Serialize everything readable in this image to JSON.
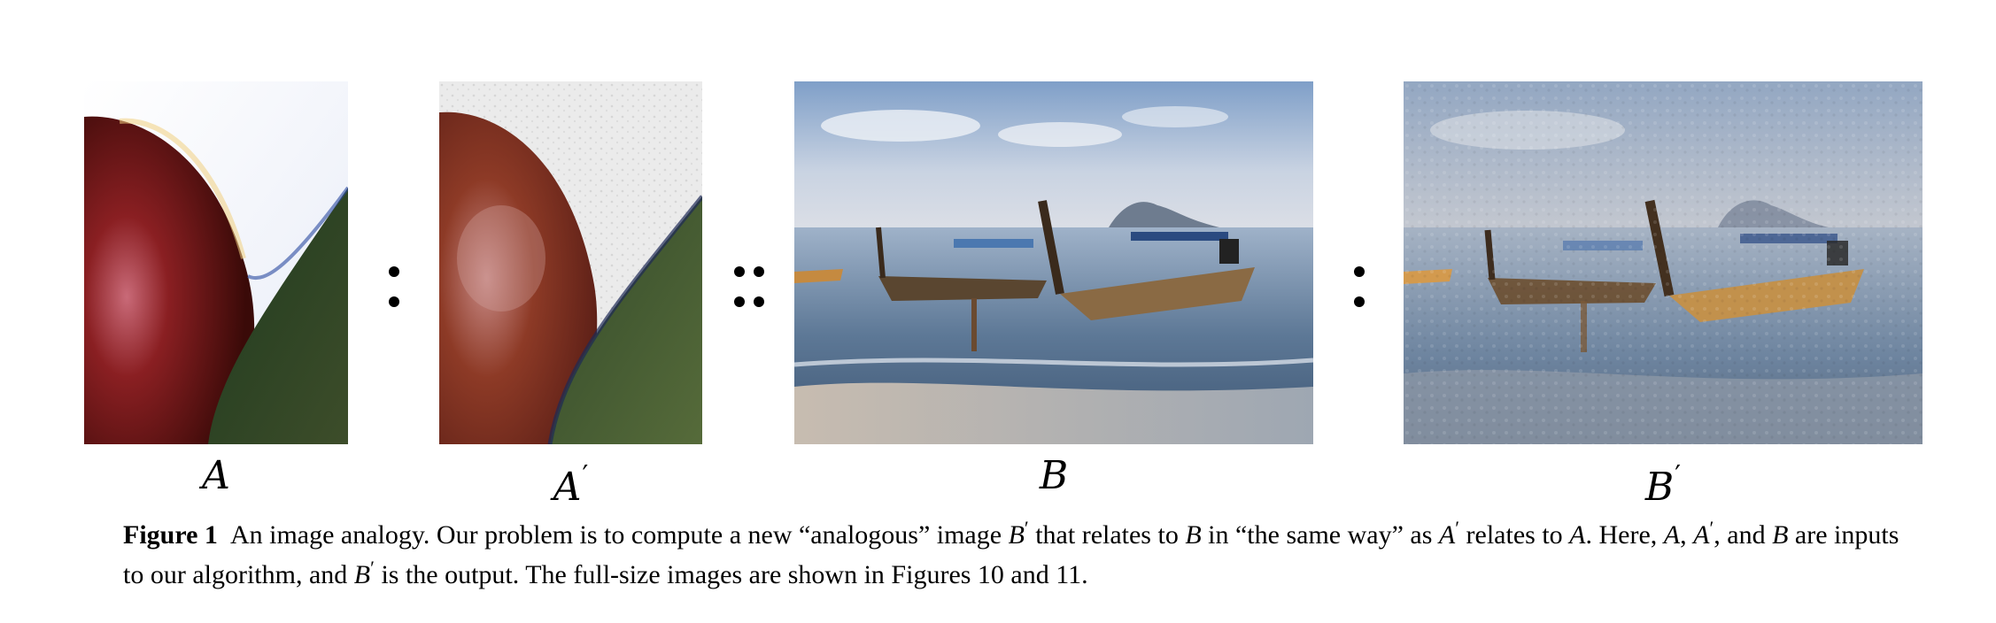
{
  "labels": {
    "a": "A",
    "a_prime": "A",
    "b": "B",
    "b_prime": "B",
    "prime": "′"
  },
  "caption": {
    "label": "Figure 1",
    "t1": "An image analogy. Our problem is to compute a new “analogous” image ",
    "m_bp": "B",
    "t2": " that relates to ",
    "m_b": "B",
    "t3": " in “the same way” as ",
    "m_ap": "A",
    "t4": " relates to ",
    "m_a": "A",
    "t5": ". Here, ",
    "m_a2": "A",
    "t6": ", ",
    "m_ap2": "A",
    "t7": ", and ",
    "m_b2": "B",
    "t8": " are inputs to our algorithm, and ",
    "m_bp2": "B",
    "t9": " is the output. The full-size images are shown in Figures 10 and 11.",
    "prime": "′"
  },
  "colors": {
    "sand": "#c9c0b4",
    "sea": "#6f8aa6",
    "sky": "#bcc9da",
    "boat_wood": "#8a6a44",
    "paper": "#ecebea"
  }
}
